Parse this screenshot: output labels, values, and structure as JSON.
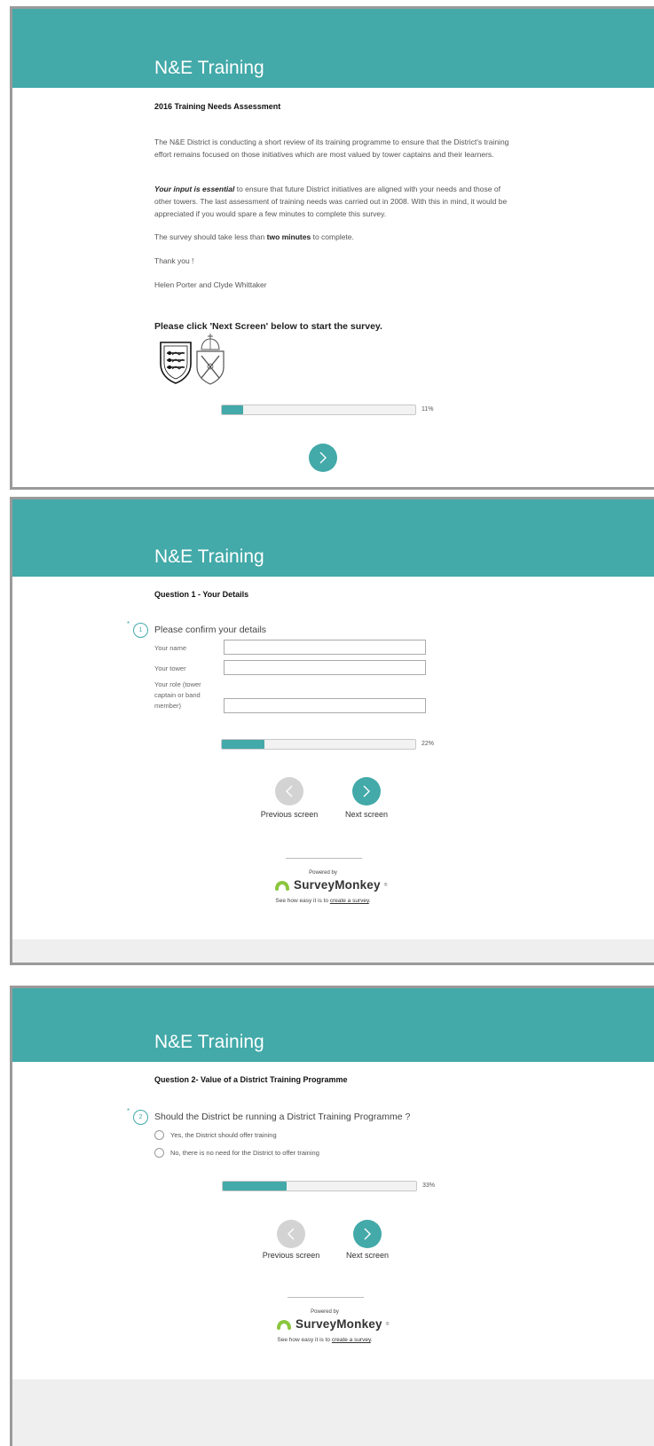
{
  "app": {
    "title": "N&E Training",
    "accent_color": "#43a9a9"
  },
  "screen1": {
    "title": "N&E Training",
    "subtitle": "2016 Training Needs Assessment",
    "para1": "The N&E District is conducting a short review of its training programme to ensure that the District's training effort remains focused on those initiatives which are most valued by tower captains and their learners.",
    "para2_emph": "Your input is essential",
    "para2_rest": " to ensure that future District initiatives are aligned with your needs and those of other towers. The last assessment of training needs was carried out in 2008. With this in mind, it would be appreciated if you would spare a few minutes to complete this survey.",
    "para3_pre": "The survey should take less than ",
    "para3_bold": "two minutes",
    "para3_post": " to complete.",
    "para4": "Thank you !",
    "para5": "Helen Porter and Clyde Whittaker",
    "cta": "Please click 'Next Screen' below to start the survey.",
    "logo_icons": [
      "shield-crest-icon",
      "bishop-mitre-crest-icon"
    ],
    "progress_pct": 11,
    "progress_label": "11%",
    "next_icon": "chevron-right-icon"
  },
  "screen2": {
    "title": "N&E Training",
    "subtitle": "Question 1 - Your Details",
    "required_mark": "*",
    "question_number": "1",
    "question_text": "Please confirm your details",
    "fields": [
      {
        "label": "Your name",
        "value": ""
      },
      {
        "label": "Your tower",
        "value": ""
      },
      {
        "label": "Your role (tower captain or band member)",
        "value": ""
      }
    ],
    "progress_pct": 22,
    "progress_label": "22%",
    "prev_label": "Previous screen",
    "next_label": "Next screen",
    "powered_by": "Powered by",
    "brand": "SurveyMonkey",
    "brand_reg": "®",
    "see_how_pre": "See how easy it is to ",
    "see_how_link": "create a survey",
    "see_how_post": "."
  },
  "screen3": {
    "title": "N&E Training",
    "subtitle": "Question 2- Value of a District Training Programme",
    "required_mark": "*",
    "question_number": "2",
    "question_text": "Should the District be running a District Training Programme ?",
    "options": [
      "Yes, the District should offer training",
      "No, there is no need for the District to offer training"
    ],
    "progress_pct": 33,
    "progress_label": "33%",
    "prev_label": "Previous screen",
    "next_label": "Next screen",
    "powered_by": "Powered by",
    "brand": "SurveyMonkey",
    "brand_reg": "®",
    "see_how_pre": "See how easy it is to ",
    "see_how_link": "create a survey",
    "see_how_post": "."
  }
}
